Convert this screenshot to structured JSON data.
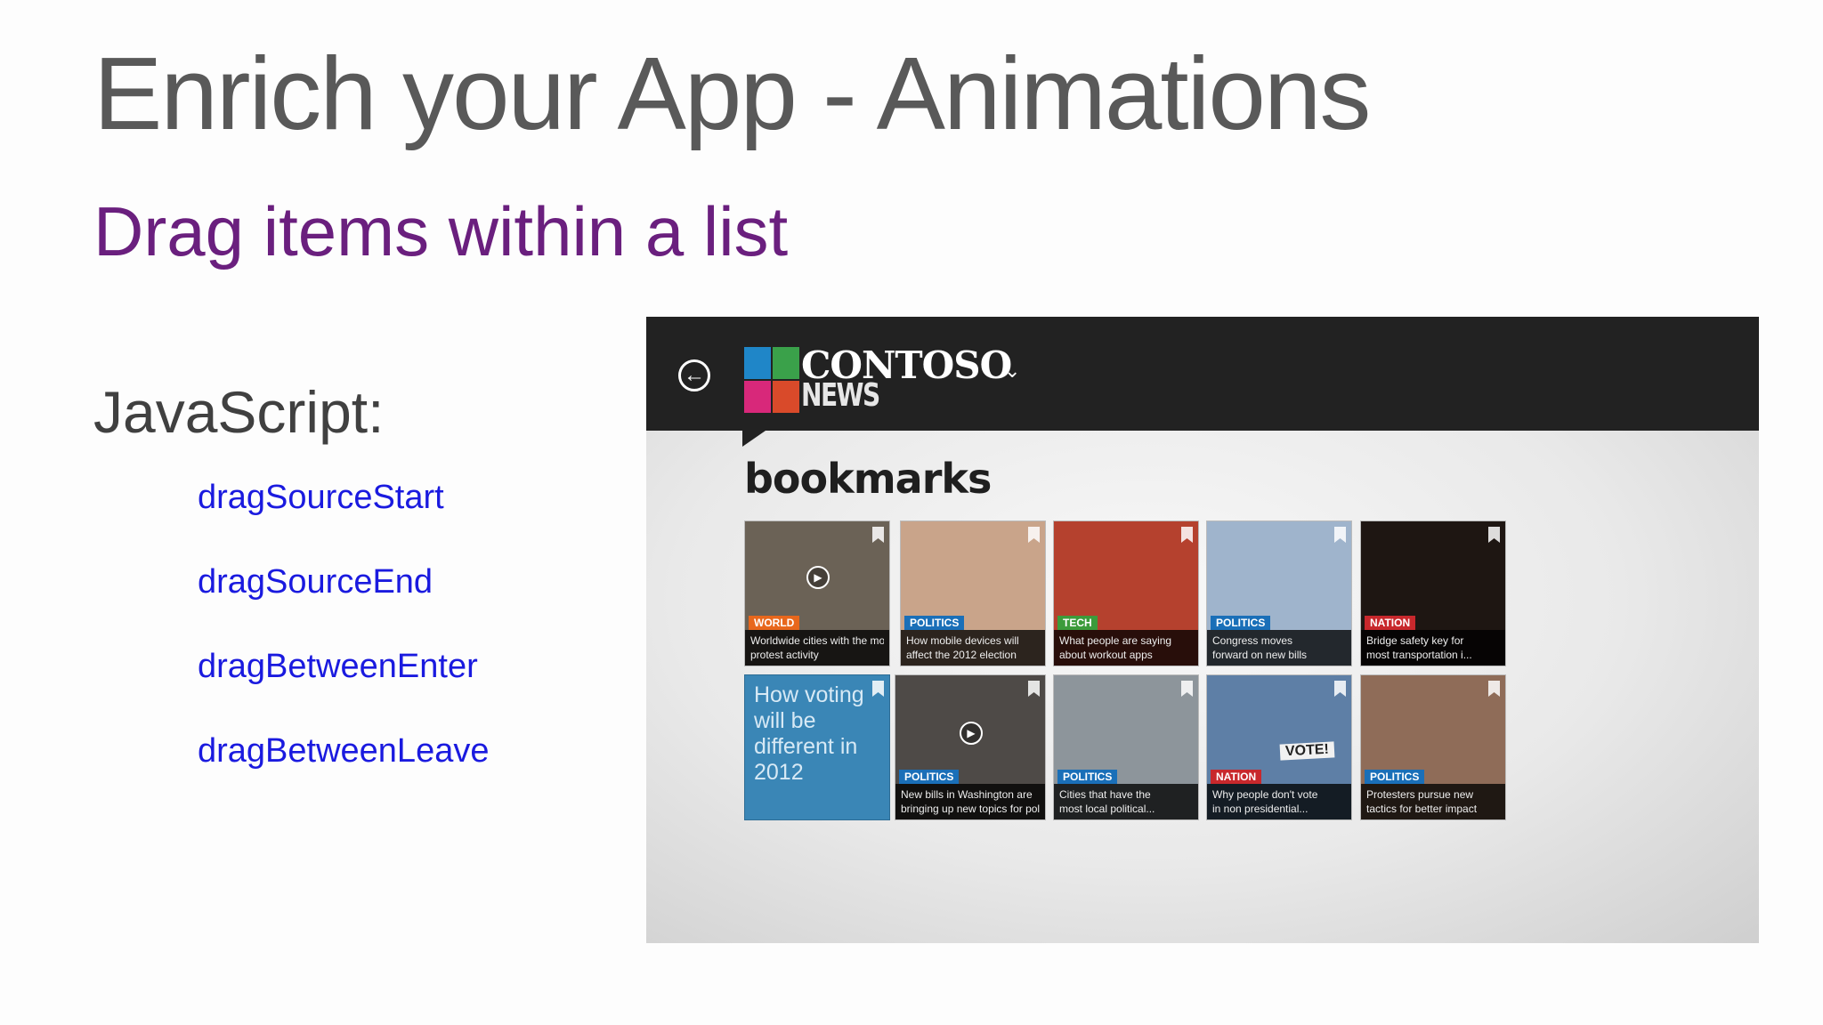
{
  "slide": {
    "title": "Enrich your App - Animations",
    "subtitle": "Drag items within a list",
    "section_label": "JavaScript:",
    "events": [
      "dragSourceStart",
      "dragSourceEnd",
      "dragBetweenEnter",
      "dragBetweenLeave"
    ]
  },
  "app": {
    "brand": {
      "name": "CONTOSO",
      "sub": "NEWS"
    },
    "back_icon": "arrow-left-circle-icon",
    "page_title": "bookmarks",
    "tiles": [
      {
        "category": "World",
        "cat_color": "#e8671c",
        "line1": "Worldwide cities with the most",
        "line2": "protest activity",
        "bg": "#6b6256",
        "play": true
      },
      {
        "category": "Politics",
        "cat_color": "#1a6fb8",
        "line1": "How mobile devices will",
        "line2": "affect the 2012 election",
        "bg": "#c9a48a",
        "play": false
      },
      {
        "category": "Tech",
        "cat_color": "#3c9b3b",
        "line1": "What people are saying",
        "line2": "about workout apps",
        "bg": "#b5412e",
        "play": false
      },
      {
        "category": "Politics",
        "cat_color": "#1a6fb8",
        "line1": "Congress moves",
        "line2": "forward on new bills",
        "bg": "#9fb4cc",
        "play": false
      },
      {
        "category": "Nation",
        "cat_color": "#c8282c",
        "line1": "Bridge safety key for",
        "line2": "most transportation i...",
        "bg": "#1e1612",
        "play": false
      },
      {
        "text_tile": true,
        "headline": "How voting will be different in 2012",
        "bg": "#3a86b6"
      },
      {
        "category": "Politics",
        "cat_color": "#1a6fb8",
        "line1": "New bills in Washington are",
        "line2": "bringing up new topics for poli...",
        "bg": "#4e4a47",
        "play": true
      },
      {
        "category": "Politics",
        "cat_color": "#1a6fb8",
        "line1": "Cities that have the",
        "line2": "most local political...",
        "bg": "#8d959b",
        "play": false
      },
      {
        "category": "Nation",
        "cat_color": "#c8282c",
        "line1": "Why people don't vote",
        "line2": "in non presidential...",
        "bg": "#5e7fa6",
        "play": false,
        "vote": "VOTE!"
      },
      {
        "category": "Politics",
        "cat_color": "#1a6fb8",
        "line1": "Protesters pursue new",
        "line2": "tactics for better impact",
        "bg": "#8f6c58",
        "play": false
      }
    ]
  }
}
